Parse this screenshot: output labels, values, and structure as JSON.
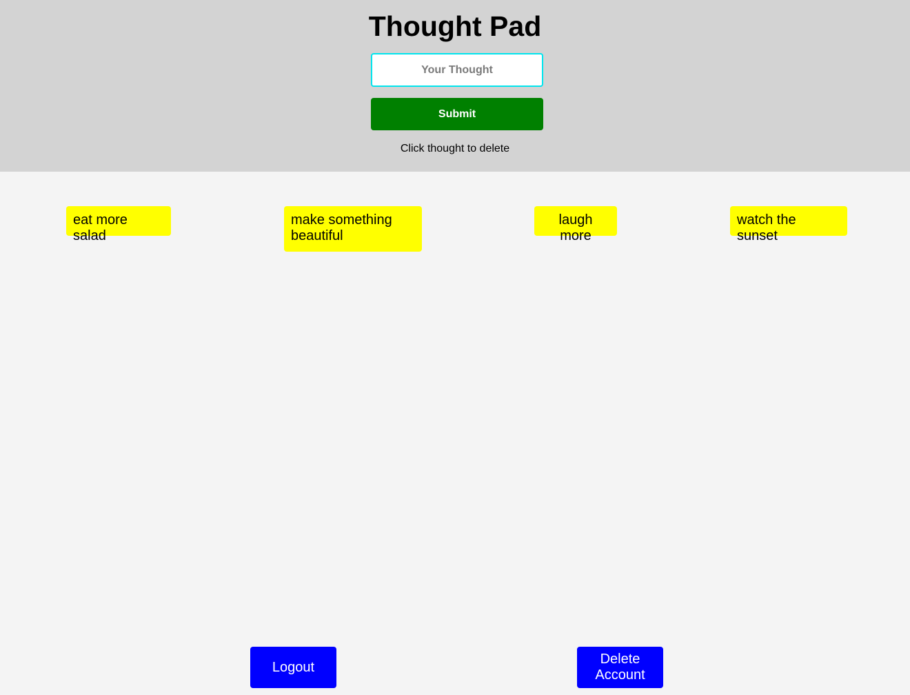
{
  "header": {
    "title": "Thought Pad",
    "input_placeholder": "Your Thought",
    "input_value": "",
    "submit_label": "Submit",
    "hint": "Click thought to delete"
  },
  "thoughts": [
    {
      "text": "eat more salad"
    },
    {
      "text": "make something beautiful"
    },
    {
      "text": "laugh more"
    },
    {
      "text": "watch the sunset"
    }
  ],
  "footer": {
    "logout_label": "Logout",
    "delete_account_label": "Delete Account"
  },
  "colors": {
    "header_bg": "#d3d3d3",
    "page_bg": "#f4f4f4",
    "submit_bg": "#008000",
    "thought_bg": "#ffff00",
    "footer_button_bg": "#0000ff",
    "input_border": "#00e5ee"
  }
}
